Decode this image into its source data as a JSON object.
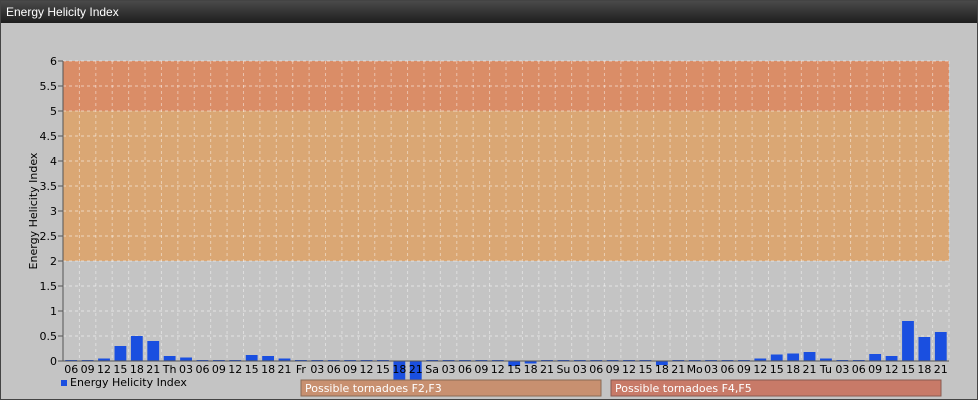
{
  "window": {
    "title": "Energy Helicity Index"
  },
  "colors": {
    "zone_low": "#d8b8a8",
    "zone_mid": "#e0a060",
    "zone_high": "#e08050",
    "bar": "#1a4fe0",
    "plot_bg": "#c4c4c4"
  },
  "chart_data": {
    "type": "bar",
    "ylabel": "Energy Helicity Index",
    "ylim": [
      0,
      6
    ],
    "yticks": [
      "0",
      "0.5",
      "1",
      "1.5",
      "2",
      "2.5",
      "3",
      "3.5",
      "4",
      "4.5",
      "5",
      "5.5",
      "6"
    ],
    "grid": true,
    "legend": {
      "position": "bottom-left",
      "label": "Energy Helicity Index"
    },
    "categories": [
      "06",
      "09",
      "12",
      "15",
      "18",
      "21",
      "Th",
      "03",
      "06",
      "09",
      "12",
      "15",
      "18",
      "21",
      "Fr",
      "03",
      "06",
      "09",
      "12",
      "15",
      "18",
      "21",
      "Sa",
      "03",
      "06",
      "09",
      "12",
      "15",
      "18",
      "21",
      "Su",
      "03",
      "06",
      "09",
      "12",
      "15",
      "18",
      "21",
      "Mo",
      "03",
      "06",
      "09",
      "12",
      "15",
      "18",
      "21",
      "Tu",
      "03",
      "06",
      "09",
      "12",
      "15",
      "18",
      "21"
    ],
    "series": [
      {
        "name": "Energy Helicity Index",
        "values": [
          0.02,
          0.02,
          0.05,
          0.3,
          0.5,
          0.4,
          0.1,
          0.07,
          0.02,
          0.02,
          0.02,
          0.12,
          0.1,
          0.05,
          0.02,
          0.02,
          0.02,
          0.02,
          0.02,
          0.02,
          -0.4,
          -0.4,
          0.02,
          0.02,
          0.02,
          0.02,
          0.02,
          -0.1,
          -0.05,
          0.02,
          0.02,
          0.02,
          0.02,
          0.02,
          0.02,
          0.02,
          -0.08,
          0.02,
          0.02,
          0.02,
          0.02,
          0.02,
          0.05,
          0.13,
          0.15,
          0.18,
          0.05,
          0.02,
          0.02,
          0.14,
          0.1,
          0.8,
          0.48,
          0.58
        ]
      }
    ],
    "zones": [
      {
        "from": 2,
        "to": 5,
        "label": "Possible tornadoes F2,F3"
      },
      {
        "from": 5,
        "to": 6,
        "label": "Possible tornadoes F4,F5"
      }
    ]
  }
}
